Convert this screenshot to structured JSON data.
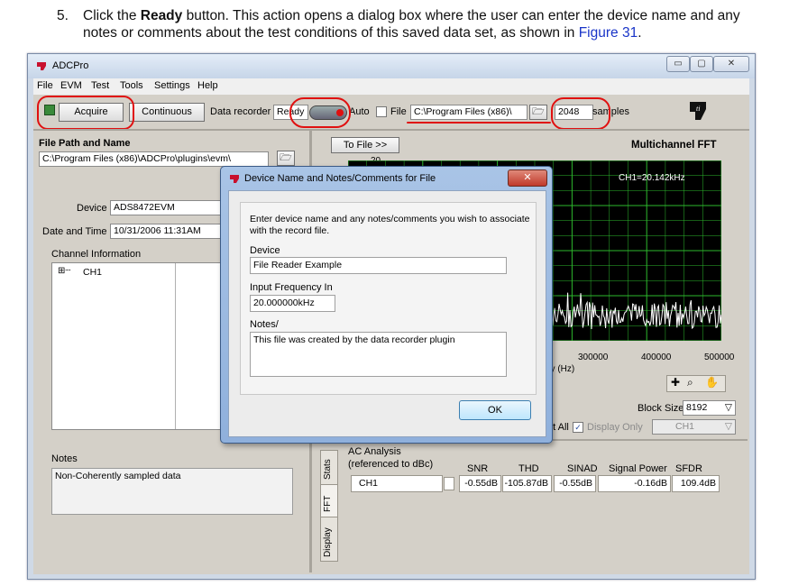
{
  "doc": {
    "step_number": "5.",
    "text_a": "Click the ",
    "text_bold": "Ready",
    "text_b": " button. This action opens a dialog box where the user can enter the device name and any notes or comments about the test conditions of this saved data set, as shown in ",
    "link": "Figure 31",
    "text_end": "."
  },
  "window": {
    "title": "ADCPro",
    "controls": [
      "▭",
      "▢",
      "✕"
    ]
  },
  "menu": [
    "File",
    "EVM",
    "Test",
    "Tools",
    "Settings",
    "Help"
  ],
  "toolbar": {
    "acquire": "Acquire",
    "continuous": "Continuous",
    "data_recorder": "Data recorder",
    "ready": "Ready",
    "auto": "Auto",
    "file": "File",
    "file_path": "C:\\Program Files (x86)\\",
    "samples_value": "2048",
    "samples": "samples"
  },
  "left": {
    "file_path_label": "File Path and Name",
    "file_path_value": "C:\\Program Files (x86)\\ADCPro\\plugins\\evm\\",
    "device_label": "Device",
    "device_value": "ADS8472EVM",
    "datetime_label": "Date and Time",
    "datetime_value": "10/31/2006 11:31AM",
    "channel_info_label": "Channel Information",
    "channel": "CH1",
    "notes_label": "Notes",
    "notes_value": "Non-Coherently sampled data"
  },
  "right": {
    "to_file": "To File >>",
    "graph_title": "Multichannel FFT",
    "y_top": "20",
    "annotation": "CH1=20.142kHz",
    "x_ticks": [
      "300000",
      "400000",
      "500000"
    ],
    "x_axis_partial": "ncy (Hz)",
    "block_size_label": "Block Size",
    "block_size_value": "8192",
    "plot_all_partial": "ot All",
    "display_only": "Display Only",
    "display_channel": "CH1",
    "tabs": [
      "Stats",
      "FFT",
      "Display"
    ],
    "ac_analysis": "AC Analysis",
    "ac_ref": "(referenced to dBc)",
    "ac_headers": [
      "SNR",
      "THD",
      "SINAD",
      "Signal Power",
      "SFDR"
    ],
    "ac_row": {
      "channel": "CH1",
      "values": [
        "-0.55dB",
        "-105.87dB",
        "-0.55dB",
        "-0.16dB",
        "109.4dB"
      ]
    }
  },
  "dialog": {
    "title": "Device Name and Notes/Comments for File",
    "instructions": "Enter device name and any notes/comments you wish to associate with the record file.",
    "device_label": "Device",
    "device_value": "File Reader Example",
    "freq_label": "Input Frequency In",
    "freq_value": "20.000000kHz",
    "notes_label": "Notes/",
    "notes_value": "This file was created by the data recorder plugin",
    "ok": "OK",
    "close": "✕"
  },
  "colors": {
    "annotation_red": "#e01010",
    "graph_grid": "#2db82d",
    "link_blue": "#1a35c8"
  }
}
